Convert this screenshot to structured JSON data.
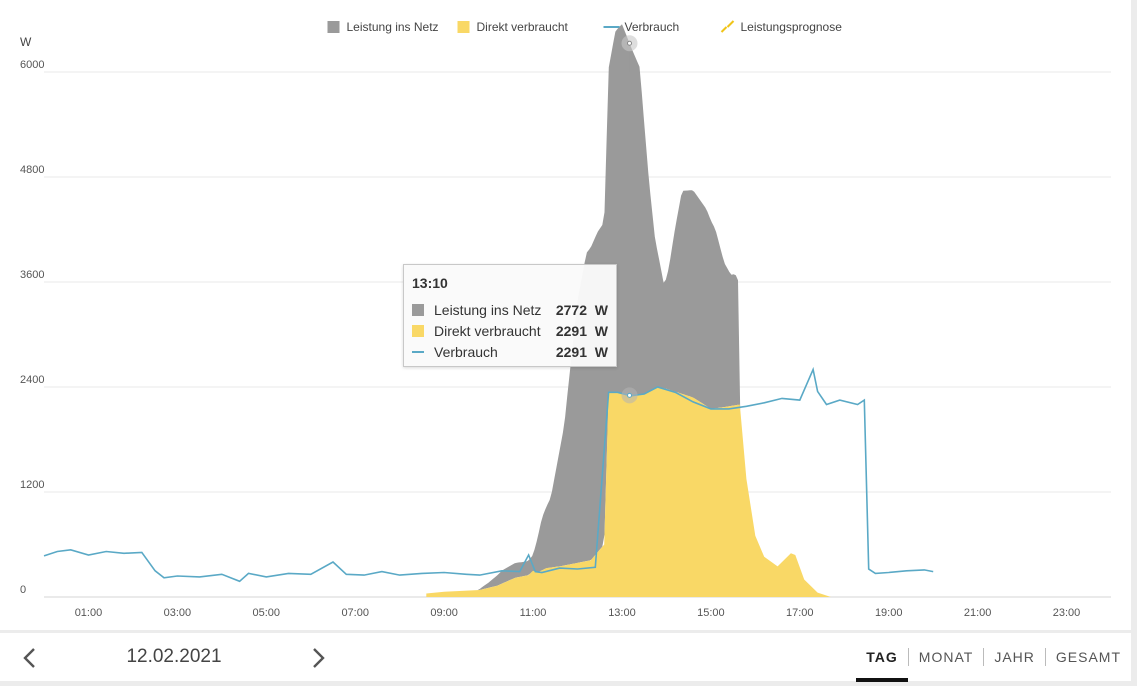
{
  "chart_data": {
    "type": "area",
    "ylabel": "W",
    "ylim": [
      0,
      6000
    ],
    "yticks": [
      "0",
      "1200",
      "2400",
      "3600",
      "4800",
      "6000"
    ],
    "xticks": [
      "01:00",
      "03:00",
      "05:00",
      "07:00",
      "09:00",
      "11:00",
      "13:00",
      "15:00",
      "17:00",
      "19:00",
      "21:00",
      "23:00"
    ],
    "xlim_hours": [
      0,
      24
    ],
    "legend_position": "top-center",
    "legend": [
      "Leistung ins Netz",
      "Direkt verbraucht",
      "Verbrauch",
      "Leistungsprognose"
    ],
    "colors": {
      "netz": "#9a9a9a",
      "direkt": "#f9d866",
      "verbrauch": "#5aa9c6",
      "prognose": "#f0c419"
    },
    "series": [
      {
        "name": "Leistung ins Netz",
        "x": [
          9.75,
          10.0,
          10.3,
          10.6,
          10.85,
          11.0,
          11.2,
          11.4,
          11.7,
          12.0,
          12.2,
          12.45,
          12.7,
          12.85,
          13.0,
          13.2,
          13.4,
          13.6,
          13.75,
          13.95,
          14.05,
          14.2,
          14.35,
          14.6,
          14.9,
          15.1,
          15.3,
          15.45,
          15.55,
          15.63,
          15.66
        ],
        "values": [
          0,
          60,
          150,
          170,
          160,
          180,
          600,
          800,
          1600,
          3000,
          3520,
          3660,
          3700,
          4120,
          4220,
          3990,
          3740,
          2450,
          1680,
          1170,
          1380,
          1880,
          2320,
          2370,
          2250,
          2050,
          1650,
          1500,
          1500,
          1400,
          0
        ]
      },
      {
        "name": "Direkt verbraucht",
        "x": [
          8.6,
          9.0,
          9.4,
          9.8,
          10.2,
          10.6,
          10.9,
          11.0,
          11.1,
          11.3,
          11.6,
          11.9,
          12.3,
          12.6,
          12.7,
          12.9,
          13.2,
          13.5,
          13.8,
          14.0,
          14.3,
          14.6,
          15.0,
          15.3,
          15.65,
          15.8,
          16.0,
          16.2,
          16.5,
          16.8,
          16.9,
          17.1,
          17.4,
          17.7
        ],
        "values": [
          40,
          60,
          70,
          80,
          130,
          220,
          250,
          300,
          280,
          330,
          350,
          380,
          420,
          600,
          2340,
          2340,
          2300,
          2320,
          2400,
          2380,
          2330,
          2280,
          2150,
          2170,
          2200,
          1350,
          700,
          460,
          350,
          500,
          480,
          200,
          50,
          0
        ]
      },
      {
        "name": "Verbrauch",
        "x": [
          0.0,
          0.3,
          0.6,
          1.0,
          1.4,
          1.8,
          2.2,
          2.5,
          2.7,
          3.0,
          3.5,
          4.0,
          4.4,
          4.6,
          5.0,
          5.5,
          6.0,
          6.5,
          6.8,
          7.2,
          7.6,
          8.0,
          8.5,
          9.0,
          9.5,
          9.8,
          10.3,
          10.7,
          10.9,
          11.05,
          11.2,
          11.6,
          12.0,
          12.4,
          12.7,
          12.9,
          13.2,
          13.5,
          13.8,
          14.2,
          14.6,
          15.0,
          15.4,
          15.8,
          16.2,
          16.6,
          17.0,
          17.3,
          17.4,
          17.6,
          17.9,
          18.3,
          18.45,
          18.55,
          18.7,
          19.0,
          19.4,
          19.8,
          20.0
        ],
        "values": [
          470,
          520,
          540,
          480,
          520,
          500,
          510,
          300,
          220,
          240,
          230,
          260,
          180,
          270,
          230,
          270,
          260,
          400,
          260,
          250,
          290,
          250,
          270,
          280,
          260,
          250,
          300,
          290,
          480,
          290,
          280,
          330,
          320,
          340,
          2340,
          2340,
          2300,
          2320,
          2400,
          2340,
          2230,
          2150,
          2150,
          2180,
          2220,
          2270,
          2250,
          2600,
          2350,
          2200,
          2250,
          2200,
          2250,
          320,
          270,
          280,
          300,
          310,
          290
        ]
      },
      {
        "name": "Leistungsprognose",
        "x": [],
        "values": []
      }
    ]
  },
  "tooltip": {
    "time": "13:10",
    "rows": [
      {
        "name": "Leistung ins Netz",
        "value": "2772  W",
        "color": "#9a9a9a",
        "kind": "square"
      },
      {
        "name": "Direkt verbraucht",
        "value": "2291  W",
        "color": "#f9d866",
        "kind": "square"
      },
      {
        "name": "Verbrauch",
        "value": "2291  W",
        "color": "#5aa9c6",
        "kind": "line"
      }
    ]
  },
  "cursor_hour": 13.17,
  "footer": {
    "date": "12.02.2021",
    "prev_icon": "chevron-left-icon",
    "next_icon": "chevron-right-icon",
    "tabs": [
      {
        "label": "TAG",
        "active": true
      },
      {
        "label": "MONAT",
        "active": false
      },
      {
        "label": "JAHR",
        "active": false
      },
      {
        "label": "GESAMT",
        "active": false
      }
    ]
  }
}
